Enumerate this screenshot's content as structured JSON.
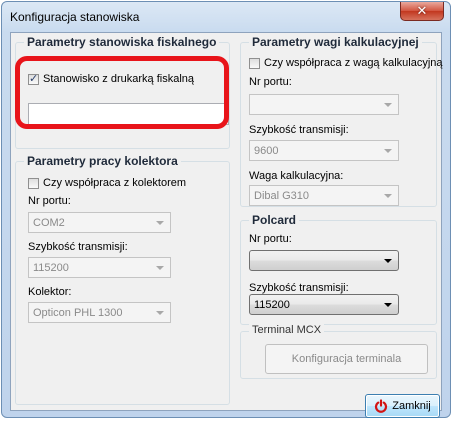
{
  "window": {
    "title": "Konfiguracja stanowiska",
    "close_icon": "close-x-icon"
  },
  "fiscal": {
    "legend": "Parametry stanowiska fiskalnego",
    "checkbox_label": "Stanowisko z drukarką fiskalną",
    "checked": true,
    "input_value": ""
  },
  "collector": {
    "legend": "Parametry pracy kolektora",
    "checkbox_label": "Czy współpraca z kolektorem",
    "checked": false,
    "port_label": "Nr portu:",
    "port_value": "COM2",
    "speed_label": "Szybkość transmisji:",
    "speed_value": "115200",
    "device_label": "Kolektor:",
    "device_value": "Opticon PHL 1300"
  },
  "scale": {
    "legend": "Parametry wagi kalkulacyjnej",
    "checkbox_label": "Czy współpraca z wagą kalkulacyjną",
    "checked": false,
    "port_label": "Nr portu:",
    "port_value": "",
    "speed_label": "Szybkość transmisji:",
    "speed_value": "9600",
    "model_label": "Waga kalkulacyjna:",
    "model_value": "Dibal G310"
  },
  "polcard": {
    "legend": "Polcard",
    "port_label": "Nr portu:",
    "port_value": "",
    "speed_label": "Szybkość transmisji:",
    "speed_value": "115200"
  },
  "terminal": {
    "legend": "Terminal MCX",
    "config_button": "Konfiguracja terminala"
  },
  "footer": {
    "close_button": "Zamknij",
    "close_icon": "power-icon"
  },
  "colors": {
    "highlight": "#e8141a"
  }
}
